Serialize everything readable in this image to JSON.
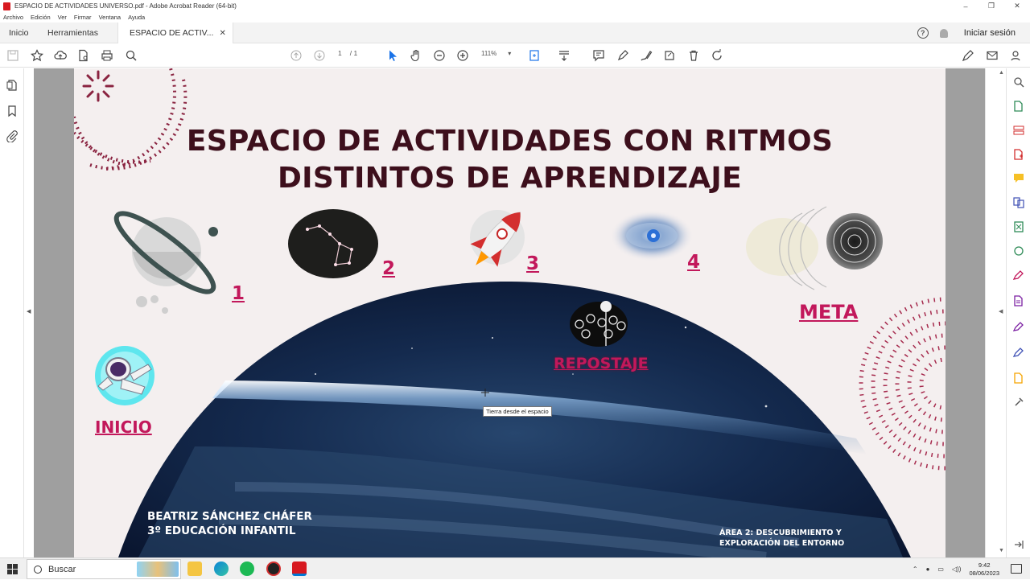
{
  "window": {
    "title": "ESPACIO DE ACTIVIDADES UNIVERSO.pdf - Adobe Acrobat Reader (64-bit)",
    "minimize": "–",
    "maximize": "❐",
    "close": "✕"
  },
  "menu": [
    "Archivo",
    "Edición",
    "Ver",
    "Firmar",
    "Ventana",
    "Ayuda"
  ],
  "tabs": {
    "home": "Inicio",
    "tools": "Herramientas",
    "document": "ESPACIO DE ACTIV...",
    "close": "✕"
  },
  "header_right": {
    "help": "?",
    "sign_in": "Iniciar sesión"
  },
  "toolbar": {
    "page_current": "1",
    "page_total": "/ 1",
    "zoom": "111%",
    "zoom_caret": "▾"
  },
  "slide": {
    "title_line1": "ESPACIO DE ACTIVIDADES CON RITMOS",
    "title_line2": "DISTINTOS DE APRENDIZAJE",
    "steps": [
      "1",
      "2",
      "3",
      "4"
    ],
    "goal": "META",
    "refuel": "REPOSTAJE",
    "start": "INICIO",
    "author_line1": "BEATRIZ SÁNCHEZ CHÁFER",
    "author_line2": "3º EDUCACIÓN INFANTIL",
    "area_line1": "ÁREA 2: DESCUBRIMIENTO Y",
    "area_line2": "EXPLORACIÓN DEL ENTORNO",
    "tooltip": "Tierra desde el espacio"
  },
  "taskbar": {
    "search": "Buscar",
    "time": "9:42",
    "date": "08/06/2023"
  },
  "colors": {
    "title": "#3d0f1c",
    "accent": "#c2185b",
    "acrobat": "#d71920"
  }
}
